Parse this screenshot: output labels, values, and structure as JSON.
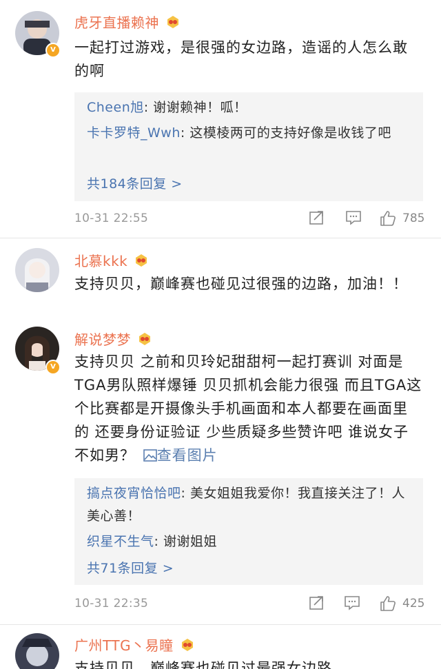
{
  "comments": [
    {
      "name": "虎牙直播赖神",
      "text": "一起打过游戏，是很强的女边路，造谣的人怎么敢的啊",
      "replies": [
        {
          "name": "Cheen旭",
          "text": ": 谢谢赖神！呱！"
        },
        {
          "name": "卡卡罗特_Wwh",
          "text": ": 这模棱两可的支持好像是收钱了吧"
        }
      ],
      "reply_count": "共184条回复 >",
      "time": "10-31 22:55",
      "likes": "785"
    },
    {
      "name": "北慕kkk",
      "text": "支持贝贝，巅峰赛也碰见过很强的边路，加油！！"
    },
    {
      "name": "解说梦梦",
      "text": "支持贝贝 之前和贝玲妃甜甜柯一起打赛训 对面是TGA男队照样爆锤 贝贝抓机会能力很强 而且TGA这个比赛都是开摄像头手机画面和本人都要在画面里的 还要身份证验证 少些质疑多些赞许吧 谁说女子不如男？",
      "view_image": "查看图片",
      "replies": [
        {
          "name": "搞点夜宵恰恰吧",
          "text": ": 美女姐姐我爱你！我直接关注了！人美心善！"
        },
        {
          "name": "织星不生气",
          "text": ": 谢谢姐姐"
        }
      ],
      "reply_count": "共71条回复 >",
      "time": "10-31 22:35",
      "likes": "425"
    },
    {
      "name": "广州TTG丶易瞳",
      "text": "支持贝贝，巅峰赛也碰见过最强女边路"
    }
  ],
  "icons": {
    "medal": "medal-icon",
    "verified": "verified-v-icon",
    "repost": "repost-icon",
    "comment": "comment-icon",
    "like": "thumbs-up-icon",
    "image": "image-icon"
  },
  "colors": {
    "name": "#eb7350",
    "link": "#4a74b0",
    "reply_bg": "#f4f4f4",
    "meta": "#999999"
  }
}
